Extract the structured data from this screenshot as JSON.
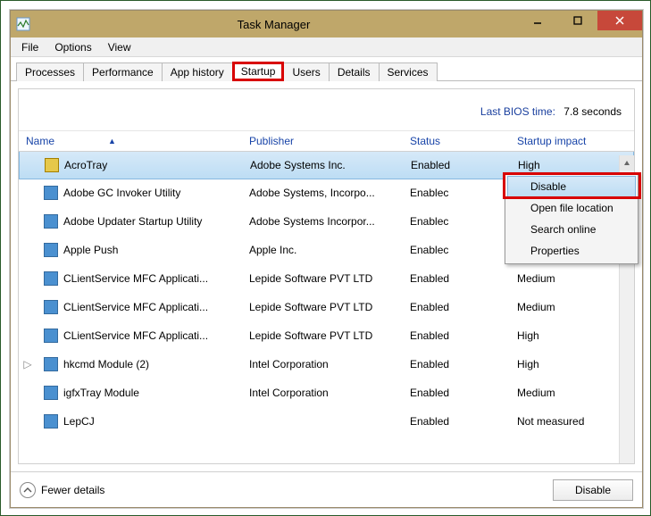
{
  "window": {
    "title": "Task Manager"
  },
  "menu": {
    "file": "File",
    "options": "Options",
    "view": "View"
  },
  "tabs": [
    {
      "label": "Processes"
    },
    {
      "label": "Performance"
    },
    {
      "label": "App history"
    },
    {
      "label": "Startup"
    },
    {
      "label": "Users"
    },
    {
      "label": "Details"
    },
    {
      "label": "Services"
    }
  ],
  "active_tab": 3,
  "bios": {
    "label": "Last BIOS time:",
    "value": "7.8 seconds"
  },
  "columns": {
    "name": "Name",
    "publisher": "Publisher",
    "status": "Status",
    "impact": "Startup impact"
  },
  "rows": [
    {
      "icon": "warn",
      "name": "AcroTray",
      "publisher": "Adobe Systems Inc.",
      "status": "Enabled",
      "impact": "High",
      "selected": true
    },
    {
      "icon": "generic",
      "name": "Adobe GC Invoker Utility",
      "publisher": "Adobe Systems, Incorpo...",
      "status": "Enablec",
      "impact": ""
    },
    {
      "icon": "generic",
      "name": "Adobe Updater Startup Utility",
      "publisher": "Adobe Systems Incorpor...",
      "status": "Enablec",
      "impact": ""
    },
    {
      "icon": "generic",
      "name": "Apple Push",
      "publisher": "Apple Inc.",
      "status": "Enablec",
      "impact": ""
    },
    {
      "icon": "generic",
      "name": "CLientService MFC Applicati...",
      "publisher": "Lepide Software PVT LTD",
      "status": "Enabled",
      "impact": "Medium"
    },
    {
      "icon": "generic",
      "name": "CLientService MFC Applicati...",
      "publisher": "Lepide Software PVT LTD",
      "status": "Enabled",
      "impact": "Medium"
    },
    {
      "icon": "generic",
      "name": "CLientService MFC Applicati...",
      "publisher": "Lepide Software PVT LTD",
      "status": "Enabled",
      "impact": "High"
    },
    {
      "icon": "generic",
      "name": "hkcmd Module (2)",
      "publisher": "Intel Corporation",
      "status": "Enabled",
      "impact": "High",
      "expandable": true
    },
    {
      "icon": "generic",
      "name": "igfxTray Module",
      "publisher": "Intel Corporation",
      "status": "Enabled",
      "impact": "Medium"
    },
    {
      "icon": "generic",
      "name": "LepCJ",
      "publisher": "",
      "status": "Enabled",
      "impact": "Not measured"
    }
  ],
  "context_menu": {
    "items": [
      {
        "label": "Disable",
        "hovered": true
      },
      {
        "label": "Open file location"
      },
      {
        "label": "Search online"
      },
      {
        "label": "Properties"
      }
    ]
  },
  "footer": {
    "fewer": "Fewer details",
    "disable": "Disable"
  }
}
